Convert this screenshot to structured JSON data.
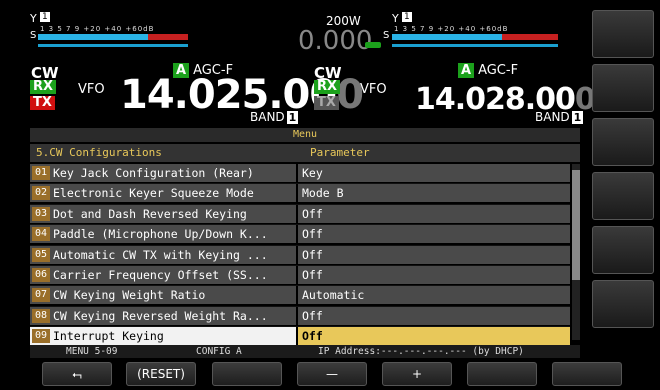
{
  "left_vfo": {
    "s_label": "S",
    "s_scale": "1  3  5  7  9   +20  +40 +60dB",
    "mode": "CW",
    "rx": "RX",
    "tx": "TX",
    "agc_badge": "A",
    "agc": "AGC-F",
    "vfo": "VFO",
    "freq_main": "14.025.00",
    "freq_dim": "0",
    "band": "BAND",
    "band_num": "1"
  },
  "center": {
    "power": "200W",
    "power_value": "0.000"
  },
  "right_vfo": {
    "s_label": "S",
    "s_scale": "1  3  5  7  9   +20  +40 +60dB",
    "mode": "CW",
    "rx": "RX",
    "tx": "TX",
    "agc_badge": "A",
    "agc": "AGC-F",
    "vfo": "VFO",
    "freq_main": "14.028.00",
    "freq_dim": "0",
    "band": "BAND",
    "band_num": "1"
  },
  "menu": {
    "title": "Menu",
    "section": "5.CW Configurations",
    "param_header": "Parameter",
    "rows": [
      {
        "num": "01",
        "label": "Key Jack Configuration (Rear)",
        "value": "Key"
      },
      {
        "num": "02",
        "label": "Electronic Keyer Squeeze Mode",
        "value": "Mode B"
      },
      {
        "num": "03",
        "label": "Dot and Dash Reversed Keying",
        "value": "Off"
      },
      {
        "num": "04",
        "label": "Paddle (Microphone Up/Down K...",
        "value": "Off"
      },
      {
        "num": "05",
        "label": "Automatic CW TX with Keying ...",
        "value": "Off"
      },
      {
        "num": "06",
        "label": "Carrier Frequency Offset (SS...",
        "value": "Off"
      },
      {
        "num": "07",
        "label": "CW Keying Weight Ratio",
        "value": "Automatic"
      },
      {
        "num": "08",
        "label": "CW Keying Reversed Weight Ra...",
        "value": "Off"
      },
      {
        "num": "09",
        "label": "Interrupt Keying",
        "value": "Off"
      }
    ]
  },
  "footer": {
    "menu_id": "MENU 5-09",
    "config": "CONFIG A",
    "ip": "IP Address:---.---.---.--- (by DHCP)"
  },
  "fkeys": {
    "back": "⮢",
    "reset": "(RESET)",
    "minus": "—",
    "plus": "+"
  },
  "colors": {
    "accent": "#e8c85a",
    "row_bg": "#4a4a4a",
    "num_bg": "#9a6f2a",
    "rx_green": "#1ca11c",
    "tx_red": "#d01010"
  }
}
